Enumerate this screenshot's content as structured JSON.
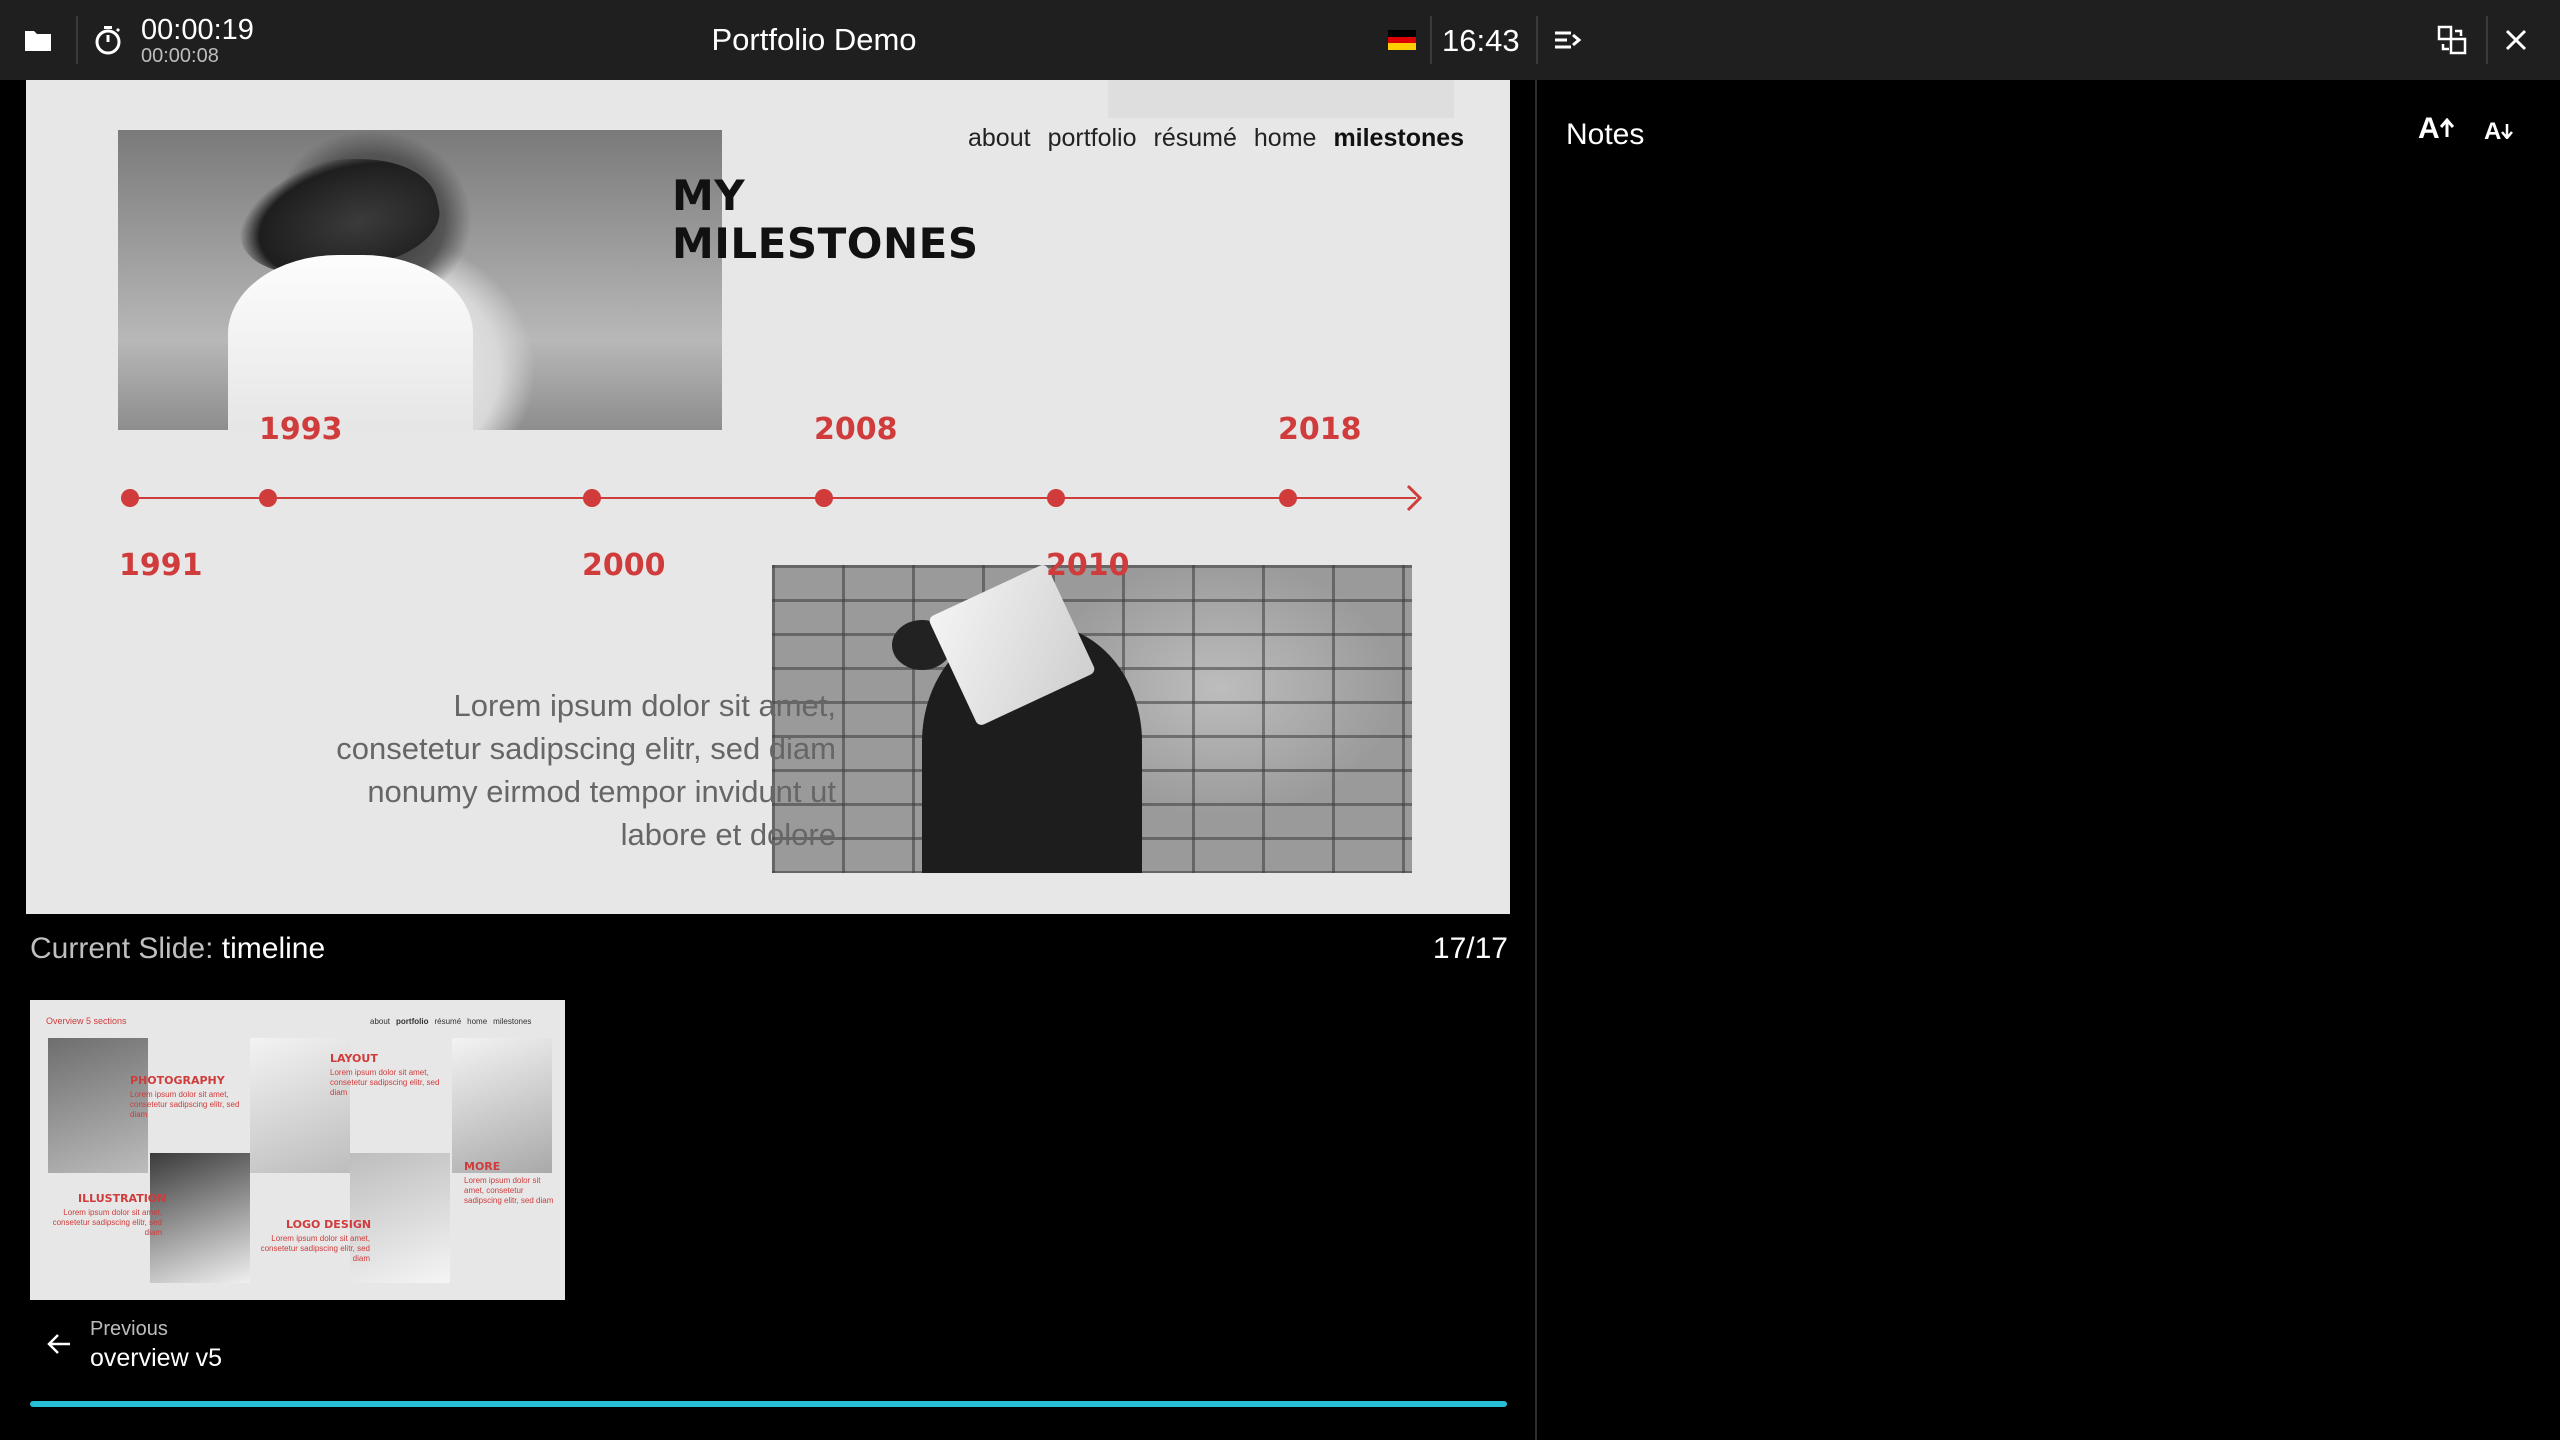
{
  "topbar": {
    "elapsed": "00:00:19",
    "slide_elapsed": "00:00:08",
    "title": "Portfolio Demo",
    "clock": "16:43",
    "flag_colors": [
      "#000000",
      "#dd0000",
      "#ffce00"
    ],
    "icons": {
      "folder": "folder-icon",
      "timer": "stopwatch-icon",
      "notes_toggle": "notes-arrow-icon",
      "layout": "swap-layout-icon",
      "close": "close-icon"
    }
  },
  "slide": {
    "nav": [
      "about",
      "portfolio",
      "résumé",
      "home",
      "milestones"
    ],
    "nav_active": "milestones",
    "heading_line1": "MY",
    "heading_line2": "MILESTONES",
    "years_top": [
      "1993",
      "2008",
      "2018"
    ],
    "years_bottom": [
      "1991",
      "2000",
      "2010"
    ],
    "body": [
      "Lorem ipsum dolor sit amet,",
      "consetetur sadipscing elitr, sed diam",
      "nonumy eirmod tempor invidunt ut",
      "labore et dolore"
    ],
    "accent": "#d03b3b"
  },
  "current_slide": {
    "label": "Current Slide:",
    "name": "timeline",
    "counter": "17/17"
  },
  "thumbnail": {
    "overview_label": "Overview 5 sections",
    "nav": [
      "about",
      "portfolio",
      "résumé",
      "home",
      "milestones"
    ],
    "sections": [
      "PHOTOGRAPHY",
      "LAYOUT",
      "ILLUSTRATION",
      "LOGO DESIGN",
      "MORE"
    ],
    "lorem": "Lorem ipsum dolor sit amet, consetetur sadipscing elitr, sed diam"
  },
  "previous": {
    "label": "Previous",
    "title": "overview v5"
  },
  "progress": {
    "fraction": 1.0,
    "color": "#26bfd6"
  },
  "notes": {
    "title": "Notes",
    "font_increase": "A",
    "font_decrease": "A"
  }
}
